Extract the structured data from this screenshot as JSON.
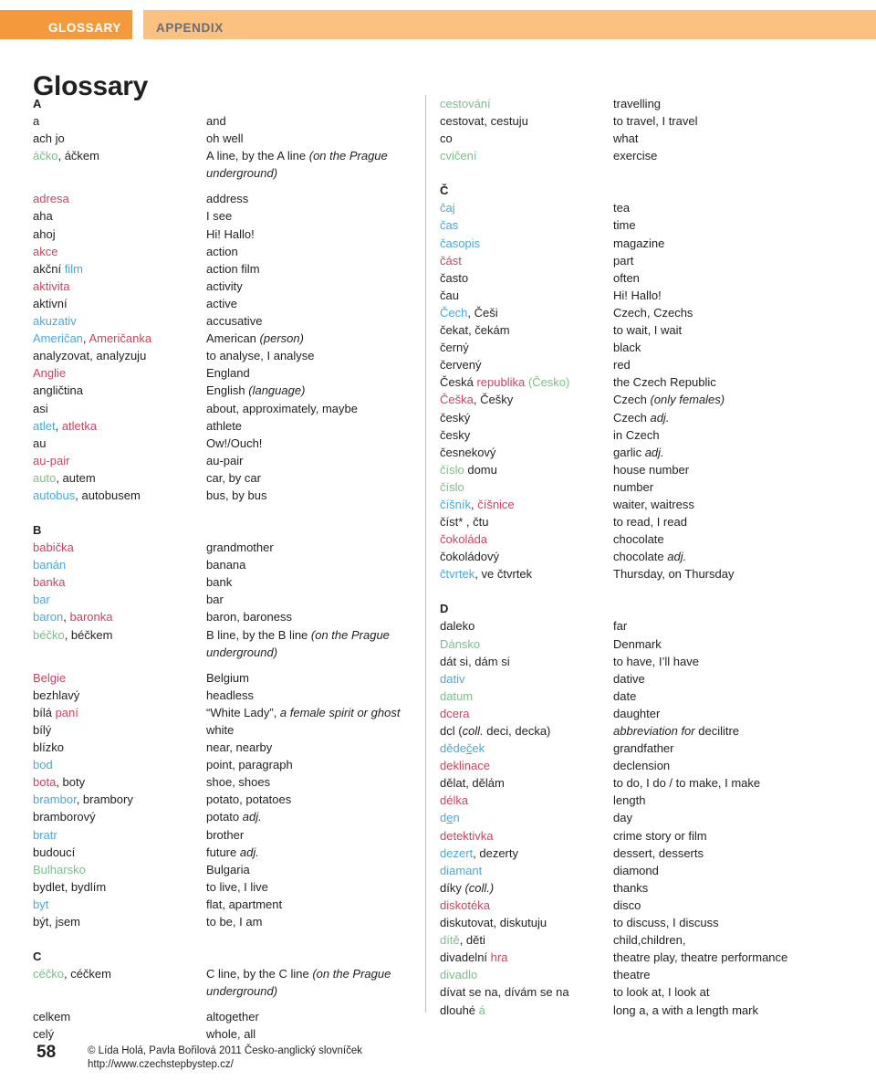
{
  "header": {
    "primary_label": "GLOSSARY",
    "secondary_label": "APPENDIX",
    "primary_color": "#F49A3C",
    "secondary_color": "#FBC181"
  },
  "page_title": "Glossary",
  "colors": {
    "masculine": "#4BA8D8",
    "feminine": "#CC4360",
    "neuter": "#7CBF8A",
    "text": "#231F20"
  },
  "footer": {
    "page_number": "58",
    "copyright": "© Lída Holá, Pavla Bořilová 2011 Česko-anglický slovníček",
    "url": "http://www.czechstepbystep.cz/"
  },
  "columns": [
    {
      "id": "left",
      "blocks": [
        {
          "type": "letter",
          "label": "A",
          "spaced": false
        },
        {
          "type": "entry",
          "term_html": "a",
          "def_html": "and"
        },
        {
          "type": "entry",
          "term_html": "ach jo",
          "def_html": "oh well"
        },
        {
          "type": "entry",
          "wrap": true,
          "term_html": "<span class='n'>áčko</span>, áčkem",
          "def_html": "A line, by the A line <span class='it'>(on the Prague underground)</span>"
        },
        {
          "type": "entry",
          "term_html": "<span class='f'>adresa</span>",
          "def_html": "address"
        },
        {
          "type": "entry",
          "term_html": "aha",
          "def_html": "I see"
        },
        {
          "type": "entry",
          "term_html": "ahoj",
          "def_html": "Hi! Hallo!"
        },
        {
          "type": "entry",
          "term_html": "<span class='f'>akce</span>",
          "def_html": "action"
        },
        {
          "type": "entry",
          "term_html": "akční <span class='m'>film</span>",
          "def_html": "action film"
        },
        {
          "type": "entry",
          "term_html": "<span class='f'>aktivita</span>",
          "def_html": "activity"
        },
        {
          "type": "entry",
          "term_html": "aktivní",
          "def_html": "active"
        },
        {
          "type": "entry",
          "term_html": "<span class='m'>akuzativ</span>",
          "def_html": "accusative"
        },
        {
          "type": "entry",
          "term_html": "<span class='m'>Američan</span>, <span class='f'>Američanka</span>",
          "def_html": "American <span class='it'>(person)</span>"
        },
        {
          "type": "entry",
          "term_html": "analyzovat, analyzuju",
          "def_html": "to analyse, I analyse"
        },
        {
          "type": "entry",
          "term_html": "<span class='f'>Anglie</span>",
          "def_html": "England"
        },
        {
          "type": "entry",
          "term_html": "angličtina",
          "def_html": "English <span class='it'>(language)</span>"
        },
        {
          "type": "entry",
          "term_html": "asi",
          "def_html": "about, approximately, maybe"
        },
        {
          "type": "entry",
          "term_html": "<span class='m'>atlet</span>, <span class='f'>atletka</span>",
          "def_html": "athlete"
        },
        {
          "type": "entry",
          "term_html": "au",
          "def_html": "Ow!/Ouch!"
        },
        {
          "type": "entry",
          "term_html": "<span class='f'>au-pair</span>",
          "def_html": "au-pair"
        },
        {
          "type": "entry",
          "term_html": "<span class='n'>auto</span>, autem",
          "def_html": "car, by car"
        },
        {
          "type": "entry",
          "term_html": "<span class='m'>autobus</span>, autobusem",
          "def_html": "bus, by bus"
        },
        {
          "type": "letter",
          "label": "B",
          "spaced": true
        },
        {
          "type": "entry",
          "term_html": "<span class='f'>babička</span>",
          "def_html": "grandmother"
        },
        {
          "type": "entry",
          "term_html": "<span class='m'>banán</span>",
          "def_html": "banana"
        },
        {
          "type": "entry",
          "term_html": "<span class='f'>banka</span>",
          "def_html": "bank"
        },
        {
          "type": "entry",
          "term_html": "<span class='m'>bar</span>",
          "def_html": "bar"
        },
        {
          "type": "entry",
          "term_html": "<span class='m'>baron</span>, <span class='f'>baronka</span>",
          "def_html": "baron, baroness"
        },
        {
          "type": "entry",
          "wrap": true,
          "term_html": "<span class='n'>béčko</span>, béčkem",
          "def_html": "B line, by the B line <span class='it'>(on the Prague underground)</span>"
        },
        {
          "type": "entry",
          "term_html": "<span class='f'>Belgie</span>",
          "def_html": "Belgium"
        },
        {
          "type": "entry",
          "term_html": "bezhlavý",
          "def_html": "headless"
        },
        {
          "type": "entry",
          "term_html": "bílá <span class='f'>paní</span>",
          "def_html": "&ldquo;White Lady&rdquo;, <span class='it'>a female spirit or ghost</span>"
        },
        {
          "type": "entry",
          "term_html": "bílý",
          "def_html": "white"
        },
        {
          "type": "entry",
          "term_html": "blízko",
          "def_html": "near, nearby"
        },
        {
          "type": "entry",
          "term_html": "<span class='m'>bod</span>",
          "def_html": "point, paragraph"
        },
        {
          "type": "entry",
          "term_html": "<span class='f'>bota</span>, boty",
          "def_html": "shoe, shoes"
        },
        {
          "type": "entry",
          "term_html": "<span class='m'>brambor</span>, brambory",
          "def_html": "potato, potatoes"
        },
        {
          "type": "entry",
          "term_html": "bramborový",
          "def_html": "potato <span class='it'>adj.</span>"
        },
        {
          "type": "entry",
          "term_html": "<span class='m'>bratr</span>",
          "def_html": "brother"
        },
        {
          "type": "entry",
          "term_html": "budoucí",
          "def_html": "future <span class='it'>adj.</span>"
        },
        {
          "type": "entry",
          "term_html": "<span class='n'>Bulharsko</span>",
          "def_html": "Bulgaria"
        },
        {
          "type": "entry",
          "term_html": "bydlet, bydlím",
          "def_html": "to live, I live"
        },
        {
          "type": "entry",
          "term_html": "<span class='m'>byt</span>",
          "def_html": "flat, apartment"
        },
        {
          "type": "entry",
          "term_html": "být, jsem",
          "def_html": "to be, I am"
        },
        {
          "type": "letter",
          "label": "C",
          "spaced": true
        },
        {
          "type": "entry",
          "wrap": true,
          "term_html": "<span class='n'>céčko</span>, céčkem",
          "def_html": "C line, by the C line <span class='it'>(on the Prague underground)</span>"
        },
        {
          "type": "entry",
          "term_html": "celkem",
          "def_html": "altogether"
        },
        {
          "type": "entry",
          "term_html": "celý",
          "def_html": "whole, all"
        }
      ]
    },
    {
      "id": "right",
      "blocks": [
        {
          "type": "entry",
          "term_html": "<span class='n'>cestování</span>",
          "def_html": "travelling"
        },
        {
          "type": "entry",
          "term_html": "cestovat, cestuju",
          "def_html": "to travel, I travel"
        },
        {
          "type": "entry",
          "term_html": "co",
          "def_html": "what"
        },
        {
          "type": "entry",
          "term_html": "<span class='n'>cvičení</span>",
          "def_html": "exercise"
        },
        {
          "type": "letter",
          "label": "Č",
          "spaced": true
        },
        {
          "type": "entry",
          "term_html": "<span class='m'>čaj</span>",
          "def_html": "tea"
        },
        {
          "type": "entry",
          "term_html": "<span class='m'>čas</span>",
          "def_html": "time"
        },
        {
          "type": "entry",
          "term_html": "<span class='m'>časopis</span>",
          "def_html": "magazine"
        },
        {
          "type": "entry",
          "term_html": "<span class='f'>část</span>",
          "def_html": "part"
        },
        {
          "type": "entry",
          "term_html": "často",
          "def_html": "often"
        },
        {
          "type": "entry",
          "term_html": "čau",
          "def_html": "Hi! Hallo!"
        },
        {
          "type": "entry",
          "term_html": "<span class='m'>Čech</span>, Češi",
          "def_html": "Czech, Czechs"
        },
        {
          "type": "entry",
          "term_html": "čekat, čekám",
          "def_html": "to wait, I wait"
        },
        {
          "type": "entry",
          "term_html": "černý",
          "def_html": "black"
        },
        {
          "type": "entry",
          "term_html": "červený",
          "def_html": "red"
        },
        {
          "type": "entry",
          "term_html": "Česká <span class='f'>republika</span> <span class='n'>(Česko)</span>",
          "def_html": "the Czech Republic"
        },
        {
          "type": "entry",
          "term_html": "<span class='f'>Češka</span>, Češky",
          "def_html": "Czech <span class='it'>(only females)</span>"
        },
        {
          "type": "entry",
          "term_html": "český",
          "def_html": "Czech <span class='it'>adj.</span>"
        },
        {
          "type": "entry",
          "term_html": "česky",
          "def_html": "in Czech"
        },
        {
          "type": "entry",
          "term_html": "česnekový",
          "def_html": "garlic <span class='it'>adj.</span>"
        },
        {
          "type": "entry",
          "term_html": "<span class='n'>číslo</span> domu",
          "def_html": "house number"
        },
        {
          "type": "entry",
          "term_html": "<span class='n'>číslo</span>",
          "def_html": "number"
        },
        {
          "type": "entry",
          "term_html": "<span class='m'>číšník</span>, <span class='f'>číšnice</span>",
          "def_html": "waiter, waitress"
        },
        {
          "type": "entry",
          "term_html": "číst* , čtu",
          "def_html": "to read, I read"
        },
        {
          "type": "entry",
          "term_html": "<span class='f'>čokoláda</span>",
          "def_html": "chocolate"
        },
        {
          "type": "entry",
          "term_html": "čokoládový",
          "def_html": "chocolate <span class='it'>adj.</span>"
        },
        {
          "type": "entry",
          "term_html": "<span class='m'>čtvrtek</span>, ve čtvrtek",
          "def_html": "Thursday, on Thursday"
        },
        {
          "type": "letter",
          "label": "D",
          "spaced": true
        },
        {
          "type": "entry",
          "term_html": "daleko",
          "def_html": "far"
        },
        {
          "type": "entry",
          "term_html": "<span class='n'>Dánsko</span>",
          "def_html": "Denmark"
        },
        {
          "type": "entry",
          "term_html": "dát si, dám si",
          "def_html": "to have, I&rsquo;ll have"
        },
        {
          "type": "entry",
          "term_html": "<span class='m'>dativ</span>",
          "def_html": "dative"
        },
        {
          "type": "entry",
          "term_html": "<span class='n'>datum</span>",
          "def_html": "date"
        },
        {
          "type": "entry",
          "term_html": "<span class='f'>dcera</span>",
          "def_html": "daughter"
        },
        {
          "type": "entry",
          "term_html": "dcl (<span class='it'>coll.</span> deci, decka)",
          "def_html": "<span class='it'>abbreviation for</span> decilitre"
        },
        {
          "type": "entry",
          "term_html": "<span class='m'>děde<span class='ul'>č</span>ek</span>",
          "def_html": "grandfather"
        },
        {
          "type": "entry",
          "term_html": "<span class='f'>deklinace</span>",
          "def_html": "declension"
        },
        {
          "type": "entry",
          "term_html": "dělat, dělám",
          "def_html": "to do, I do / to make, I make"
        },
        {
          "type": "entry",
          "term_html": "<span class='f'>délka</span>",
          "def_html": "length"
        },
        {
          "type": "entry",
          "term_html": "<span class='m'>d<span class='ul'>e</span>n</span>",
          "def_html": "day"
        },
        {
          "type": "entry",
          "term_html": "<span class='f'>detektivka</span>",
          "def_html": "crime story or film"
        },
        {
          "type": "entry",
          "term_html": "<span class='m'>dezert</span>, dezerty",
          "def_html": "dessert, desserts"
        },
        {
          "type": "entry",
          "term_html": "<span class='m'>diamant</span>",
          "def_html": "diamond"
        },
        {
          "type": "entry",
          "term_html": "díky <span class='it'>(coll.)</span>",
          "def_html": "thanks"
        },
        {
          "type": "entry",
          "term_html": "<span class='f'>diskotéka</span>",
          "def_html": "disco"
        },
        {
          "type": "entry",
          "term_html": "diskutovat, diskutuju",
          "def_html": "to discuss, I discuss"
        },
        {
          "type": "entry",
          "term_html": "<span class='n'>dítě</span>, děti",
          "def_html": "child,children,"
        },
        {
          "type": "entry",
          "term_html": "divadelní <span class='f'>hra</span>",
          "def_html": "theatre play, theatre performance"
        },
        {
          "type": "entry",
          "term_html": "<span class='n'>divadlo</span>",
          "def_html": "theatre"
        },
        {
          "type": "entry",
          "term_html": "dívat se na, dívám se na",
          "def_html": "to look at, I look at"
        },
        {
          "type": "entry",
          "term_html": "dlouhé <span class='n'>á</span>",
          "def_html": "long a, a with a length mark"
        }
      ]
    }
  ]
}
